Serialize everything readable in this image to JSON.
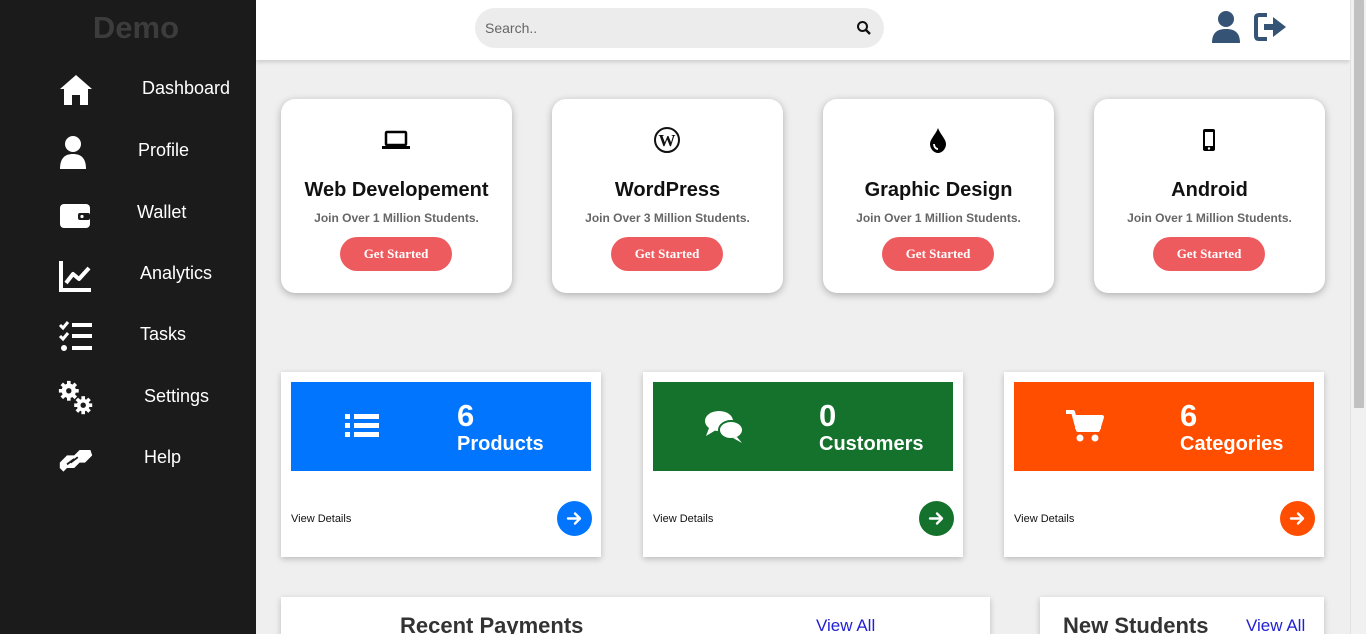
{
  "sidebar": {
    "brand": "Demo",
    "items": [
      {
        "label": "Dashboard",
        "icon": "home-icon"
      },
      {
        "label": "Profile",
        "icon": "user-icon"
      },
      {
        "label": "Wallet",
        "icon": "wallet-icon"
      },
      {
        "label": "Analytics",
        "icon": "chart-line-icon"
      },
      {
        "label": "Tasks",
        "icon": "tasks-icon"
      },
      {
        "label": "Settings",
        "icon": "cogs-icon"
      },
      {
        "label": "Help",
        "icon": "handshake-icon"
      }
    ]
  },
  "topbar": {
    "search_placeholder": "Search..",
    "icons": [
      "search-icon",
      "user-icon",
      "logout-icon"
    ]
  },
  "courses": [
    {
      "title": "Web Developement",
      "subtitle": "Join Over 1 Million Students.",
      "button": "Get Started",
      "icon": "laptop-icon"
    },
    {
      "title": "WordPress",
      "subtitle": "Join Over 3 Million Students.",
      "button": "Get Started",
      "icon": "wordpress-icon"
    },
    {
      "title": "Graphic Design",
      "subtitle": "Join Over 1 Million Students.",
      "button": "Get Started",
      "icon": "tint-icon"
    },
    {
      "title": "Android",
      "subtitle": "Join Over 1 Million Students.",
      "button": "Get Started",
      "icon": "mobile-icon"
    }
  ],
  "stats": [
    {
      "value": "6",
      "label": "Products",
      "link": "View Details",
      "color": "#0275ff",
      "icon": "list-icon"
    },
    {
      "value": "0",
      "label": "Customers",
      "link": "View Details",
      "color": "#14722c",
      "icon": "comments-icon"
    },
    {
      "value": "6",
      "label": "Categories",
      "link": "View Details",
      "color": "#ff4e00",
      "icon": "cart-icon"
    }
  ],
  "panels": [
    {
      "title": "Recent Payments",
      "link": "View All"
    },
    {
      "title": "New Students",
      "link": "View All"
    }
  ],
  "colors": {
    "sidebar_bg": "#1b1b1b",
    "button": "#ee5b5e",
    "topbar_icon": "#355374",
    "link": "#2121d4"
  }
}
